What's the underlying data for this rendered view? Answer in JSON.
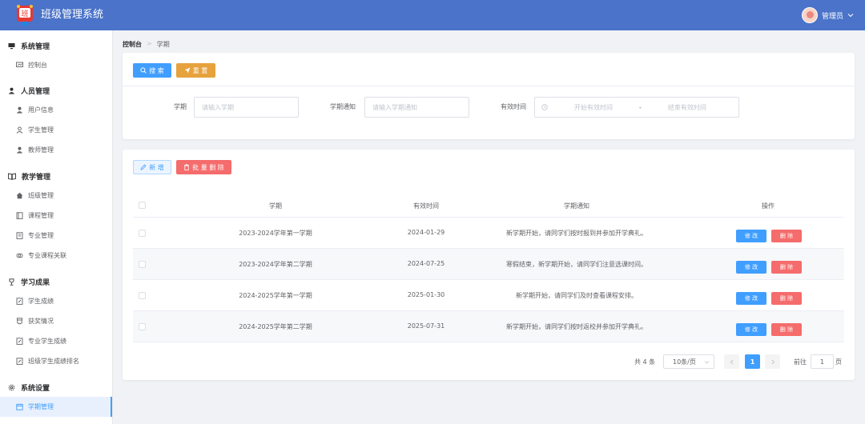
{
  "header": {
    "title": "班级管理系统",
    "user_label": "管理员",
    "logo_text": "班"
  },
  "sidebar": {
    "groups": [
      {
        "label": "系统管理",
        "items": [
          "控制台"
        ]
      },
      {
        "label": "人员管理",
        "items": [
          "用户信息",
          "学生管理",
          "教师管理"
        ]
      },
      {
        "label": "教学管理",
        "items": [
          "班级管理",
          "课程管理",
          "专业管理",
          "专业课程关联"
        ]
      },
      {
        "label": "学习成果",
        "items": [
          "学生成绩",
          "获奖情况",
          "专业学生成绩",
          "班级学生成绩排名"
        ]
      },
      {
        "label": "系统设置",
        "items": [
          "学期管理"
        ]
      }
    ],
    "active_item": "学期管理"
  },
  "breadcrumb": {
    "root": "控制台",
    "current": "学期"
  },
  "search": {
    "search_button": "搜 索",
    "reset_button": "重 置",
    "term_label": "学期",
    "term_placeholder": "请输入学期",
    "notice_label": "学期通知",
    "notice_placeholder": "请输入学期通知",
    "time_label": "有效时间",
    "start_placeholder": "开始有效时间",
    "range_sep": "-",
    "end_placeholder": "结束有效时间"
  },
  "toolbar": {
    "add_button": "新 增",
    "batch_delete_button": "批 量 删 除"
  },
  "table": {
    "columns": [
      "学期",
      "有效时间",
      "学期通知",
      "操作"
    ],
    "rows": [
      {
        "term": "2023-2024学年第一学期",
        "date": "2024-01-29",
        "notice": "新学期开始，请同学们按时报到并参加开学典礼。"
      },
      {
        "term": "2023-2024学年第二学期",
        "date": "2024-07-25",
        "notice": "寒假结束，新学期开始，请同学们注意选课时间。"
      },
      {
        "term": "2024-2025学年第一学期",
        "date": "2025-01-30",
        "notice": "新学期开始，请同学们及时查看课程安排。"
      },
      {
        "term": "2024-2025学年第二学期",
        "date": "2025-07-31",
        "notice": "新学期开始，请同学们按时返校并参加开学典礼。"
      }
    ],
    "edit_label": "修 改",
    "delete_label": "删 除"
  },
  "pagination": {
    "total": "共 4 条",
    "page_size": "10条/页",
    "current_page": "1",
    "goto_label": "前往",
    "goto_value": "1",
    "page_suffix": "页"
  },
  "colors": {
    "header": "#4a73c9",
    "primary": "#409eff",
    "warning": "#e6a23c",
    "danger": "#f56c6c"
  }
}
